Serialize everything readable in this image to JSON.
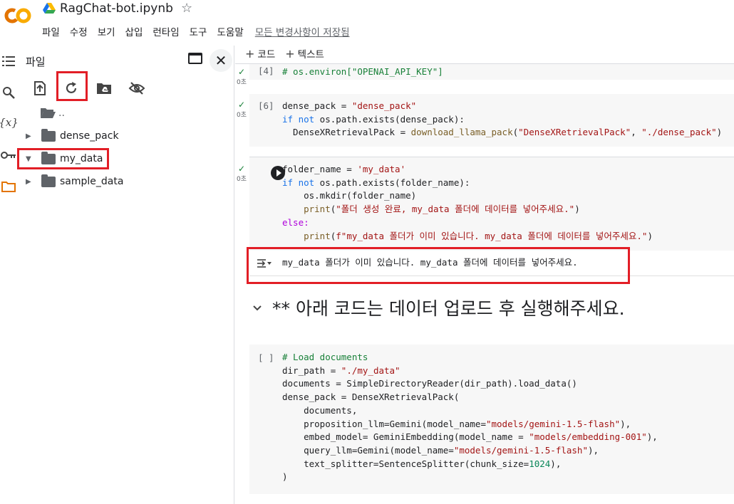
{
  "app": {
    "title": "RagChat-bot.ipynb",
    "logo_text": "CO",
    "colors": {
      "logo_orange": "#f9ab00",
      "logo_dark": "#e37400",
      "highlight_red": "#e21e26"
    }
  },
  "menu": {
    "items": [
      "파일",
      "수정",
      "보기",
      "삽입",
      "런타임",
      "도구",
      "도움말"
    ],
    "saved_status": "모든 변경사항이 저장됨"
  },
  "rail": {
    "icons": [
      "toc-icon",
      "search-icon",
      "variables-icon",
      "key-icon",
      "folder-icon"
    ],
    "variables_label": "{x}"
  },
  "panel": {
    "title": "파일",
    "tree": [
      {
        "name": "..",
        "expandable": false
      },
      {
        "name": "dense_pack",
        "expandable": true,
        "expanded": false
      },
      {
        "name": "my_data",
        "expandable": true,
        "expanded": true
      },
      {
        "name": "sample_data",
        "expandable": true,
        "expanded": false
      }
    ]
  },
  "toolbar": {
    "add_code": "코드",
    "add_text": "텍스트"
  },
  "cells": {
    "c1": {
      "exec": "[4]",
      "time": "0초",
      "line1": "# os.environ[\"OPENAI_API_KEY\"]"
    },
    "c2": {
      "exec": "[6]",
      "time": "0초",
      "line1_a": "dense_pack = ",
      "line1_b": "\"dense_pack\"",
      "line2_a": "if not",
      "line2_b": " os.path.exists(dense_pack):",
      "line3_a": "  DenseXRetrievalPack = ",
      "line3_b": "download_llama_pack",
      "line3_c": "(",
      "line3_d": "\"DenseXRetrievalPack\"",
      "line3_e": ", ",
      "line3_f": "\"./dense_pack\"",
      "line3_g": ")"
    },
    "c3": {
      "time": "0초",
      "l1a": "folder_name = ",
      "l1b": "'my_data'",
      "l2a": "if not",
      "l2b": " os.path.exists(folder_name):",
      "l3": "    os.mkdir(folder_name)",
      "l4a": "    print",
      "l4b": "(",
      "l4c": "\"폴더 생성 완료, my_data 폴더에 데이터를 넣어주세요.\"",
      "l4d": ")",
      "l5": "else:",
      "l6a": "    print",
      "l6b": "(",
      "l6c": "f\"my_data 폴더가 이미 있습니다. my_data 폴더에 데이터를 넣어주세요.\"",
      "l6d": ")",
      "output": "my_data 폴더가 이미 있습니다. my_data 폴더에 데이터를 넣어주세요."
    },
    "md_heading": "** 아래 코드는 데이터 업로드 후 실행해주세요.",
    "c4": {
      "exec": "[ ]",
      "l1": "# Load documents",
      "l2a": "dir_path = ",
      "l2b": "\"./my_data\"",
      "l3": "documents = SimpleDirectoryReader(dir_path).load_data()",
      "l4": "dense_pack = DenseXRetrievalPack(",
      "l5": "    documents,",
      "l6a": "    proposition_llm=Gemini(model_name=",
      "l6b": "\"models/gemini-1.5-flash\"",
      "l6c": "),",
      "l7a": "    embed_model= GeminiEmbedding(model_name = ",
      "l7b": "\"models/embedding-001\"",
      "l7c": "),",
      "l8a": "    query_llm=Gemini(model_name=",
      "l8b": "\"models/gemini-1.5-flash\"",
      "l8c": "),",
      "l9a": "    text_splitter=SentenceSplitter(chunk_size=",
      "l9b": "1024",
      "l9c": "),",
      "l10": ")"
    }
  }
}
